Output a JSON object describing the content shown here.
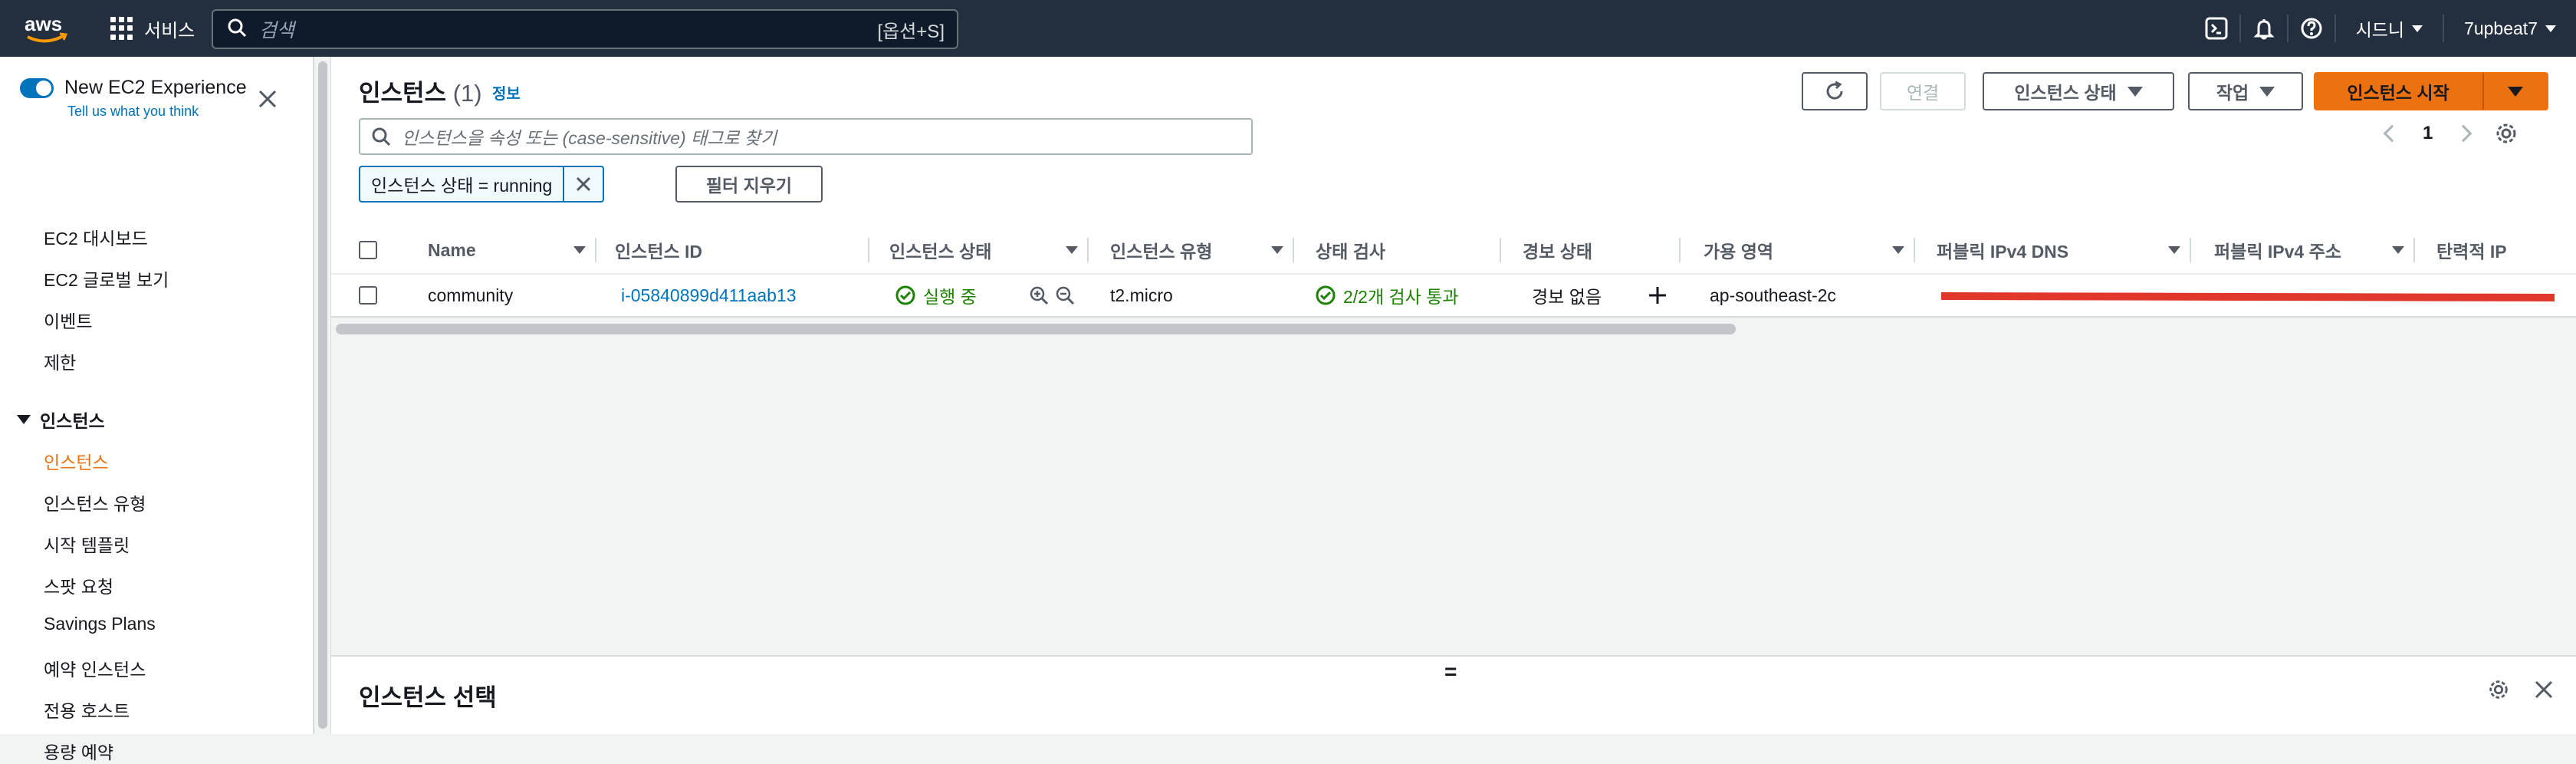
{
  "topbar": {
    "logo_text": "aws",
    "services_label": "서비스",
    "search_placeholder": "검색",
    "search_shortcut": "[옵션+S]",
    "region_label": "시드니",
    "account_label": "7upbeat7",
    "icons": [
      "cloudshell-icon",
      "bell-icon",
      "help-icon"
    ]
  },
  "sidebar": {
    "new_experience": {
      "title": "New EC2 Experience",
      "subtitle": "Tell us what you think",
      "enabled": true
    },
    "items": [
      {
        "label": "EC2 대시보드"
      },
      {
        "label": "EC2 글로벌 보기"
      },
      {
        "label": "이벤트"
      },
      {
        "label": "제한"
      }
    ],
    "section": {
      "label": "인스턴스"
    },
    "section_items": [
      {
        "label": "인스턴스",
        "active": true
      },
      {
        "label": "인스턴스 유형"
      },
      {
        "label": "시작 템플릿"
      },
      {
        "label": "스팟 요청"
      },
      {
        "label": "Savings Plans"
      },
      {
        "label": "예약 인스턴스"
      },
      {
        "label": "전용 호스트"
      },
      {
        "label": "용량 예약"
      }
    ]
  },
  "main": {
    "title": "인스턴스",
    "count": "(1)",
    "info": "정보",
    "buttons": {
      "connect": "연결",
      "instance_state": "인스턴스 상태",
      "actions": "작업",
      "launch": "인스턴스 시작"
    },
    "filter_placeholder": "인스턴스을 속성 또는 (case-sensitive) 태그로 찾기",
    "filter_token": "인스턴스 상태 = running",
    "clear_filters": "필터 지우기",
    "page": "1",
    "columns": [
      "Name",
      "인스턴스 ID",
      "인스턴스 상태",
      "인스턴스 유형",
      "상태 검사",
      "경보 상태",
      "가용 영역",
      "퍼블릭 IPv4 DNS",
      "퍼블릭 IPv4 주소",
      "탄력적 IP"
    ],
    "rows": [
      {
        "name": "community",
        "instance_id": "i-05840899d411aab13",
        "state": "실행 중",
        "type": "t2.micro",
        "status_check": "2/2개 검사 통과",
        "alarm": "경보 없음",
        "az": "ap-southeast-2c"
      }
    ],
    "details_title": "인스턴스 선택",
    "handle_glyph": "="
  },
  "colors": {
    "accent": "#ec7211",
    "link": "#0073bb",
    "success": "#1d8102",
    "topbar": "#232f3e",
    "redaction": "#e0372a"
  }
}
